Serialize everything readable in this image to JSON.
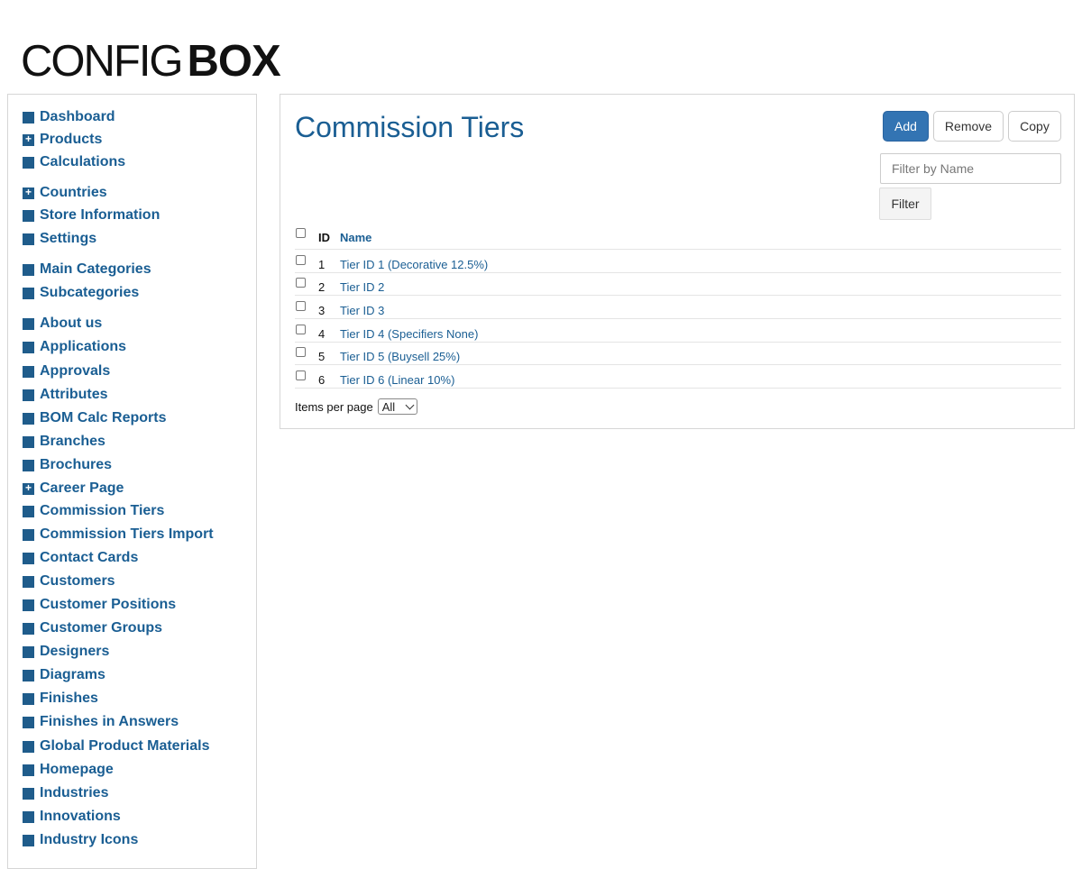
{
  "logo": {
    "part1": "CONFIG",
    "part2": "BOX"
  },
  "sidebar": {
    "items": [
      {
        "label": "Dashboard",
        "icon": "square-icon"
      },
      {
        "label": "Products",
        "icon": "plus-square-icon"
      },
      {
        "label": "Calculations",
        "icon": "square-icon"
      },
      {
        "label": "Countries",
        "icon": "plus-square-icon"
      },
      {
        "label": "Store Information",
        "icon": "square-icon"
      },
      {
        "label": "Settings",
        "icon": "square-icon"
      },
      {
        "label": "Main Categories",
        "icon": "square-icon"
      },
      {
        "label": "Subcategories",
        "icon": "square-icon"
      },
      {
        "label": "About us",
        "icon": "square-icon"
      },
      {
        "label": "Applications",
        "icon": "square-icon"
      },
      {
        "label": "Approvals",
        "icon": "square-icon"
      },
      {
        "label": "Attributes",
        "icon": "square-icon"
      },
      {
        "label": "BOM Calc Reports",
        "icon": "square-icon"
      },
      {
        "label": "Branches",
        "icon": "square-icon"
      },
      {
        "label": "Brochures",
        "icon": "square-icon"
      },
      {
        "label": "Career Page",
        "icon": "plus-square-icon"
      },
      {
        "label": "Commission Tiers",
        "icon": "square-icon"
      },
      {
        "label": "Commission Tiers Import",
        "icon": "square-icon"
      },
      {
        "label": "Contact Cards",
        "icon": "square-icon"
      },
      {
        "label": "Customers",
        "icon": "square-icon"
      },
      {
        "label": "Customer Positions",
        "icon": "square-icon"
      },
      {
        "label": "Customer Groups",
        "icon": "square-icon"
      },
      {
        "label": "Designers",
        "icon": "square-icon"
      },
      {
        "label": "Diagrams",
        "icon": "square-icon"
      },
      {
        "label": "Finishes",
        "icon": "square-icon"
      },
      {
        "label": "Finishes in Answers",
        "icon": "square-icon"
      },
      {
        "label": "Global Product Materials",
        "icon": "square-icon"
      },
      {
        "label": "Homepage",
        "icon": "square-icon"
      },
      {
        "label": "Industries",
        "icon": "square-icon"
      },
      {
        "label": "Innovations",
        "icon": "square-icon"
      },
      {
        "label": "Industry Icons",
        "icon": "square-icon"
      }
    ]
  },
  "main": {
    "title": "Commission Tiers",
    "toolbar": {
      "add_label": "Add",
      "remove_label": "Remove",
      "copy_label": "Copy"
    },
    "filter": {
      "placeholder": "Filter by Name",
      "value": "",
      "button_label": "Filter"
    },
    "table": {
      "columns": {
        "id": "ID",
        "name": "Name"
      },
      "rows": [
        {
          "id": "1",
          "name": "Tier ID 1 (Decorative 12.5%)"
        },
        {
          "id": "2",
          "name": "Tier ID 2"
        },
        {
          "id": "3",
          "name": "Tier ID 3"
        },
        {
          "id": "4",
          "name": "Tier ID 4 (Specifiers None)"
        },
        {
          "id": "5",
          "name": "Tier ID 5 (Buysell 25%)"
        },
        {
          "id": "6",
          "name": "Tier ID 6 (Linear 10%)"
        }
      ]
    },
    "pagination": {
      "items_per_page_label": "Items per page",
      "items_per_page_value": "All"
    }
  },
  "colors": {
    "accent": "#1a5e93",
    "primary_button": "#3374b3",
    "icon": "#1f5c8b"
  }
}
